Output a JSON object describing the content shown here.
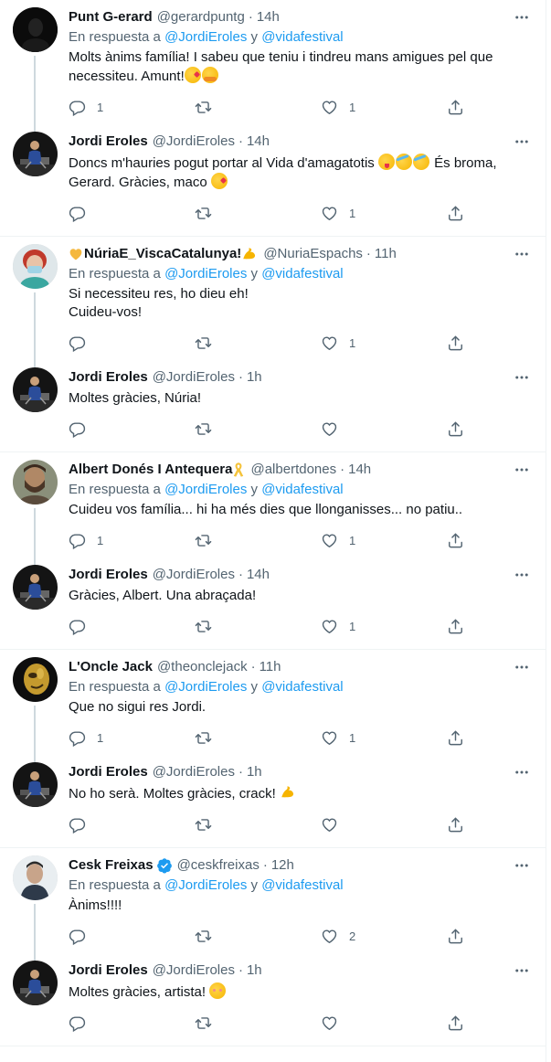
{
  "colors": {
    "accent": "#1d9bf0",
    "secondary_text": "#536471",
    "primary_text": "#0f1419",
    "divider": "#eff3f4",
    "thread_line": "#cfd9de"
  },
  "reply_prefix": "En respuesta a",
  "reply_and": "y",
  "threads": [
    {
      "tweets": [
        {
          "name": "Punt G-erard",
          "handle": "@gerardpuntg",
          "time": "14h",
          "avatar": "dark-silhouette",
          "reply_to": [
            "@JordiEroles",
            "@vidafestival"
          ],
          "text": "Molts ànims família! I sabeu que teniu i tindreu mans amigues pel que necessiteu. Amunt!",
          "emojis": [
            "kissing-heart",
            "hugging"
          ],
          "replies": "1",
          "retweets": "",
          "likes": "1"
        },
        {
          "name": "Jordi Eroles",
          "handle": "@JordiEroles",
          "time": "14h",
          "avatar": "stage-photo",
          "text_parts": [
            "Doncs m'hauries pogut portar al Vida d'amagatotis ",
            " És broma, Gerard. Gràcies, maco "
          ],
          "emojis_mid": [
            "winking-tongue",
            "rofl",
            "rofl"
          ],
          "emojis_end": [
            "kissing-heart"
          ],
          "replies": "",
          "retweets": "",
          "likes": "1"
        }
      ]
    },
    {
      "tweets": [
        {
          "name": "NúriaE_ViscaCatalunya!",
          "handle": "@NuriaEspachs",
          "time": "11h",
          "avatar": "red-hair-mask",
          "reply_to": [
            "@JordiEroles",
            "@vidafestival"
          ],
          "text_lines": [
            "Si necessiteu res, ho dieu eh!",
            "Cuideu-vos!"
          ],
          "replies": "",
          "retweets": "",
          "likes": "1"
        },
        {
          "name": "Jordi Eroles",
          "handle": "@JordiEroles",
          "time": "1h",
          "avatar": "stage-photo",
          "text": "Moltes gràcies, Núria!",
          "replies": "",
          "retweets": "",
          "likes": ""
        }
      ]
    },
    {
      "tweets": [
        {
          "name": "Albert Donés I Antequera",
          "handle": "@albertdones",
          "time": "14h",
          "avatar": "bearded-man",
          "reply_to": [
            "@JordiEroles",
            "@vidafestival"
          ],
          "text": "Cuideu vos família... hi ha més dies que llonganisses... no patiu..",
          "replies": "1",
          "retweets": "",
          "likes": "1"
        },
        {
          "name": "Jordi Eroles",
          "handle": "@JordiEroles",
          "time": "14h",
          "avatar": "stage-photo",
          "text": "Gràcies, Albert. Una abraçada!",
          "replies": "",
          "retweets": "",
          "likes": "1"
        }
      ]
    },
    {
      "tweets": [
        {
          "name": "L'Oncle Jack",
          "handle": "@theonclejack",
          "time": "11h",
          "avatar": "gold-face",
          "reply_to": [
            "@JordiEroles",
            "@vidafestival"
          ],
          "text": "Que no sigui res Jordi.",
          "replies": "1",
          "retweets": "",
          "likes": "1"
        },
        {
          "name": "Jordi Eroles",
          "handle": "@JordiEroles",
          "time": "1h",
          "avatar": "stage-photo",
          "text": "No ho serà. Moltes gràcies, crack!",
          "emojis": [
            "flexed-biceps"
          ],
          "replies": "",
          "retweets": "",
          "likes": ""
        }
      ]
    },
    {
      "tweets": [
        {
          "name": "Cesk Freixas",
          "handle": "@ceskfreixas",
          "time": "12h",
          "avatar": "man-portrait",
          "verified": true,
          "reply_to": [
            "@JordiEroles",
            "@vidafestival"
          ],
          "text": "Ànims!!!!",
          "replies": "",
          "retweets": "",
          "likes": "2"
        },
        {
          "name": "Jordi Eroles",
          "handle": "@JordiEroles",
          "time": "1h",
          "avatar": "stage-photo",
          "text": "Moltes gràcies, artista!",
          "emojis": [
            "smiling-blush"
          ],
          "replies": "",
          "retweets": "",
          "likes": ""
        }
      ]
    }
  ]
}
